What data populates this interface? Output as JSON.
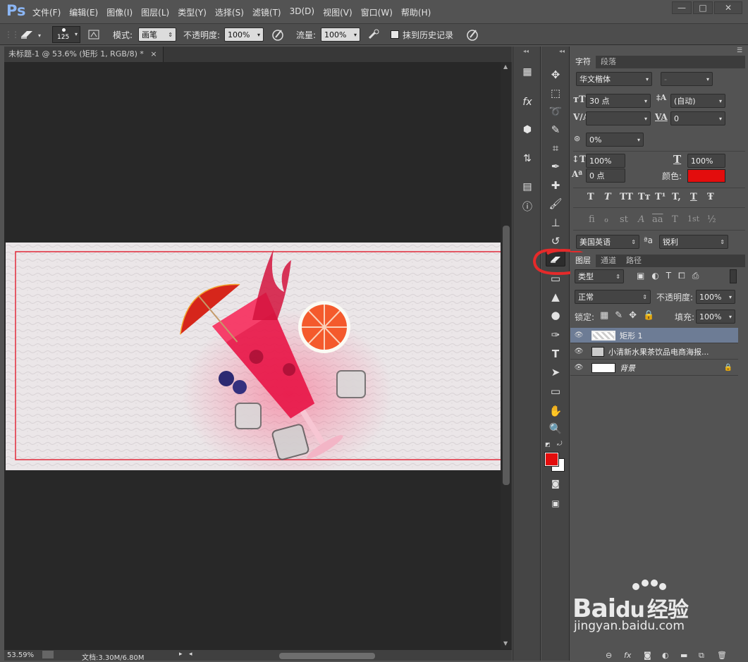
{
  "app": {
    "logo": "Ps"
  },
  "menubar": {
    "items": [
      "文件(F)",
      "编辑(E)",
      "图像(I)",
      "图层(L)",
      "类型(Y)",
      "选择(S)",
      "滤镜(T)",
      "3D(D)",
      "视图(V)",
      "窗口(W)",
      "帮助(H)"
    ],
    "window_buttons": [
      "—",
      "□",
      "✕"
    ]
  },
  "options": {
    "brush_size": "125",
    "mode_label": "模式:",
    "mode_value": "画笔",
    "opacity_label": "不透明度:",
    "opacity_value": "100%",
    "flow_label": "流量:",
    "flow_value": "100%",
    "history_label": "抹到历史记录"
  },
  "document": {
    "tab_title": "未标题-1 @ 53.6% (矩形 1, RGB/8) *",
    "close": "×"
  },
  "status": {
    "zoom": "53.59%",
    "doc_info": "文档:3.30M/6.80M"
  },
  "panel_collapse": {
    "left": "◂◂",
    "right": "◂◂"
  },
  "character": {
    "tabs": [
      "字符",
      "段落"
    ],
    "font_family": "华文楷体",
    "font_style": "-",
    "font_size": "30 点",
    "leading": "(自动)",
    "kerning": "",
    "tracking": "0",
    "scale_label": "0%",
    "vscale": "100%",
    "hscale": "100%",
    "baseline": "0 点",
    "color_label": "颜色:",
    "color_value": "#e30d0d",
    "format_buttons": [
      "T",
      "T",
      "TT",
      "Tт",
      "T¹",
      "T,",
      "T",
      "Ŧ"
    ],
    "opentype_buttons": [
      "fi",
      "ℴ",
      "st",
      "A",
      "aa",
      "T",
      "1st",
      "½"
    ],
    "language": "美国英语",
    "aa_label": "ªa",
    "antialias": "锐利"
  },
  "layers": {
    "tabs": [
      "图层",
      "通道",
      "路径"
    ],
    "filter_type": "类型",
    "blend_mode": "正常",
    "opacity_label": "不透明度:",
    "opacity_value": "100%",
    "lock_label": "锁定:",
    "fill_label": "填充:",
    "fill_value": "100%",
    "items": [
      {
        "name": "矩形 1",
        "selected": true
      },
      {
        "name": "小清新水果茶饮品电商海报...",
        "selected": false
      },
      {
        "name": "背景",
        "selected": false
      }
    ]
  },
  "watermark": {
    "brand": "Bai",
    "brand2": "du",
    "brand3": "经验",
    "url": "jingyan.baidu.com"
  },
  "colors": {
    "foreground": "#e30d0d",
    "background": "#ffffff",
    "accent": "#7c9ac6",
    "annotation": "#e52a2a"
  }
}
